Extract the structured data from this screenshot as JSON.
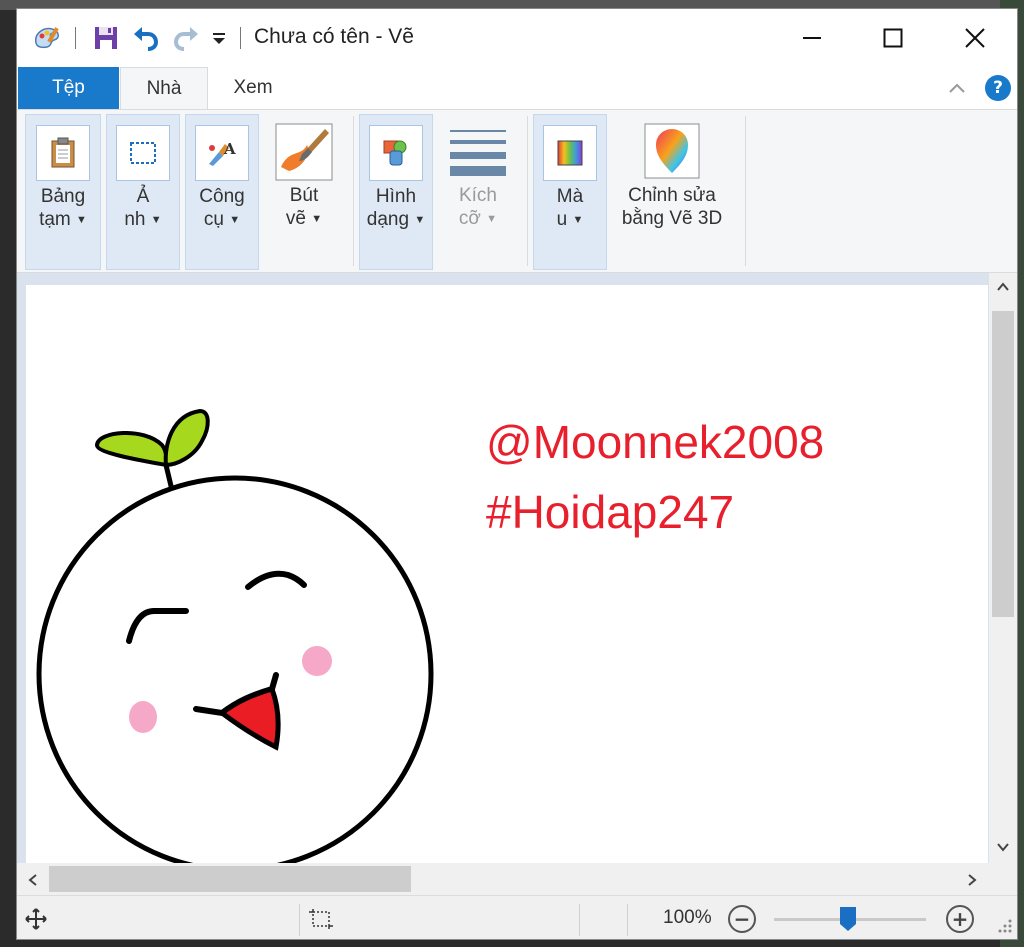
{
  "window": {
    "title": "Chưa có tên - Vẽ"
  },
  "tabs": {
    "file": "Tệp",
    "home": "Nhà",
    "view": "Xem"
  },
  "ribbon": {
    "clipboard": [
      "Bảng",
      "tạm"
    ],
    "image": [
      "Ả",
      "nh"
    ],
    "tools": [
      "Công",
      "cụ"
    ],
    "brushes": [
      "Bút",
      "vẽ"
    ],
    "shapes": [
      "Hình",
      "dạng"
    ],
    "size": [
      "Kích",
      "cỡ"
    ],
    "colors": [
      "Mà",
      "u"
    ],
    "paint3d": [
      "Chỉnh sửa",
      "bằng Vẽ 3D"
    ]
  },
  "canvas": {
    "line1": "@Moonnek2008",
    "line2": "#Hoidap247"
  },
  "status": {
    "zoom": "100%",
    "zoom_level_percent": 100
  },
  "help_label": "?",
  "colors": {
    "accent": "#1979ca",
    "text_red": "#e8202d",
    "leaf_green": "#a6d81e",
    "blush_pink": "#f6a8c8",
    "tongue_red": "#ea1c24"
  }
}
